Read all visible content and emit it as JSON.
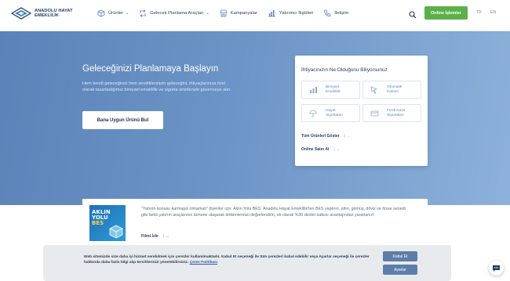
{
  "brand": {
    "name_line1": "ANADOLU HAYAT",
    "name_line2": "EMEKLİLİK"
  },
  "nav": {
    "items": [
      {
        "label": "Ürünler",
        "icon": "cube-icon",
        "has_dropdown": true
      },
      {
        "label": "Gelecek Planlama Araçları",
        "icon": "flow-arrows-icon",
        "has_dropdown": true
      },
      {
        "label": "Kampanyalar",
        "icon": "storefront-icon",
        "has_dropdown": false
      },
      {
        "label": "Yatırımcı İlişkileri",
        "icon": "bar-chart-icon",
        "has_dropdown": false
      },
      {
        "label": "İletişim",
        "icon": "phone-icon",
        "has_dropdown": false
      }
    ],
    "online_button": "Online İşlemler",
    "lang_tr": "TR",
    "lang_en": "EN"
  },
  "hero": {
    "title": "Geleceğinizi Planlamaya Başlayın",
    "description": "Hem kendi geleceğinizi hem sevdiklerinizin geleceğini, ihtiyaçlarınıza özel olarak tasarladığımız bireysel emeklilik ve sigorta ürünleriyle güvenceye alın.",
    "button": "Bana Uygun Ürünü Bul"
  },
  "needs_card": {
    "title": "İhtiyacınızın Ne Olduğunu Biliyorsunuz",
    "options": [
      {
        "line1": "Bireysel",
        "line2": "Emeklilik",
        "icon": "bar-chart-icon"
      },
      {
        "line1": "Otomatik",
        "line2": "Katılım",
        "icon": "cursor-icon"
      },
      {
        "line1": "Hayat",
        "line2": "Sigortaları",
        "icon": "umbrella-icon"
      },
      {
        "line1": "Ferdi Kaza",
        "line2": "Sigortaları",
        "icon": "card-icon"
      }
    ],
    "all_products": "Tüm Ürünleri Göster",
    "buy_online": "Online Satın Al"
  },
  "info": {
    "thumb_line1": "AKLIN",
    "thumb_line2": "YOLU",
    "thumb_line3": "BES",
    "text": "\"Yatırım konusu karmaşık olmamalı\" diyenler için: Aklın Yolu BES. Anadolu Hayat Emeklilik'ten BES yaptırın, altın, gümüş, döviz ve hisse senedi gibi farklı yatırım araçlarının tümüne ulaşarak birikimlerinizi değerlendirin, ek olarak %30 devlet katkısı avantajından yararlanın!",
    "link": "Filmi İzle"
  },
  "cookie": {
    "text": "Web sitemizde size daha iyi hizmet verebilmek için çerezler kullanılmaktadır. Kabul Et seçeneği ile tüm çerezleri kabul edebilir veya Ayarlar seçeneği ile çerezler hakkında daha fazla bilgi alıp tercihlerinizi yönetebilirsiniz.",
    "policy_link": "Çerez Politikası",
    "accept": "Kabul Et",
    "settings": "Ayarlar"
  },
  "colors": {
    "accent_green": "#5bb04a",
    "navy": "#1d3b66",
    "hero_blue": "#6c94c6"
  }
}
